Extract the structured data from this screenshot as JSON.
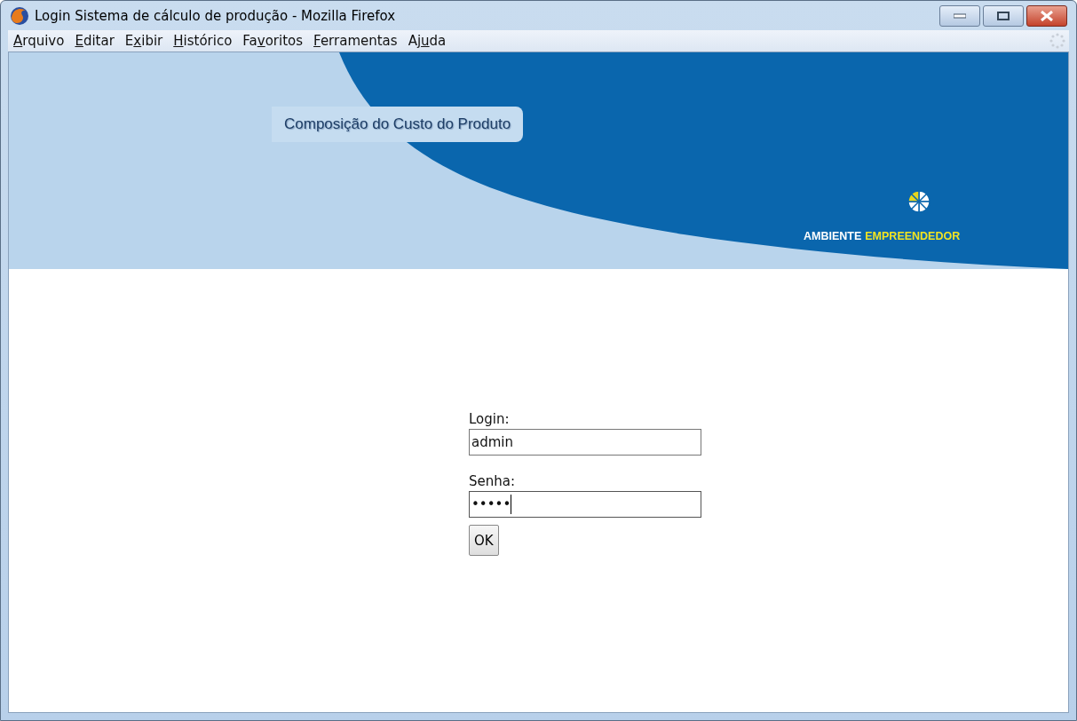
{
  "window": {
    "title": "Login Sistema de cálculo de produção - Mozilla Firefox"
  },
  "menu": [
    {
      "key": "A",
      "post": "rquivo"
    },
    {
      "key": "E",
      "post": "ditar"
    },
    {
      "pre": "E",
      "key": "x",
      "post": "ibir"
    },
    {
      "key": "H",
      "post": "istórico"
    },
    {
      "pre": "Fa",
      "key": "v",
      "post": "oritos"
    },
    {
      "key": "F",
      "post": "erramentas"
    },
    {
      "pre": "Aj",
      "key": "u",
      "post": "da"
    }
  ],
  "banner": {
    "title": "Composição do Custo do Produto",
    "brand_first": "AMBIENTE",
    "brand_second": "EMPREENDEDOR"
  },
  "form": {
    "fields": [
      {
        "label": "Login:",
        "value": "admin",
        "kind": "text",
        "focused": false
      },
      {
        "label": "Senha:",
        "value": "•••••",
        "kind": "password",
        "focused": true
      }
    ],
    "submit": "OK"
  }
}
